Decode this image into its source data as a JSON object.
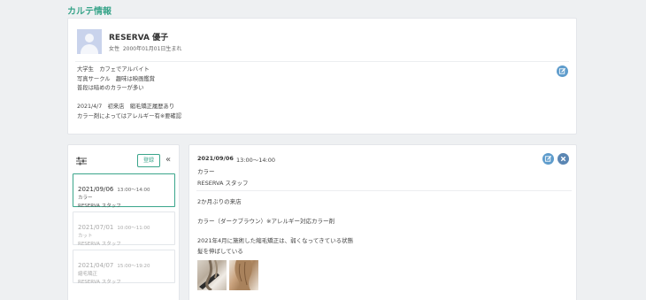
{
  "page": {
    "title": "カルテ情報"
  },
  "profile": {
    "name": "RESERVA 優子",
    "gender": "女性",
    "birthday": "2000年01月01日生まれ",
    "notes": [
      "大学生　カフェでアルバイト",
      "写真サークル　趣味は映画鑑賞",
      "普段は暗めのカラーが多い",
      "",
      "2021/4/7　初来店　縮毛矯正履歴あり",
      "カラー剤によってはアレルギー有※要確認"
    ]
  },
  "list": {
    "register_label": "登録",
    "collapse_glyph": "«",
    "items": [
      {
        "date": "2021/09/06",
        "time": "13:00～14:00",
        "menu": "カラー",
        "staff": "RESERVA スタッフ"
      },
      {
        "date": "2021/07/01",
        "time": "10:00～11:00",
        "menu": "カット",
        "staff": "RESERVA スタッフ"
      },
      {
        "date": "2021/04/07",
        "time": "15:00～19:20",
        "menu": "縮毛矯正",
        "staff": "RESERVA スタッフ"
      }
    ]
  },
  "detail": {
    "date": "2021/09/06",
    "time": "13:00～14:00",
    "menu": "カラー",
    "staff": "RESERVA スタッフ",
    "body": [
      "2か月ぶりの来店",
      "カラー（ダークブラウン）※アレルギー対応カラー剤",
      "2021年4月に施術した縮毛矯正は、弱くなってきている状態",
      "髪を伸ばしている"
    ]
  },
  "colors": {
    "accent": "#3aa58b",
    "action_blue": "#5e9ccc"
  }
}
